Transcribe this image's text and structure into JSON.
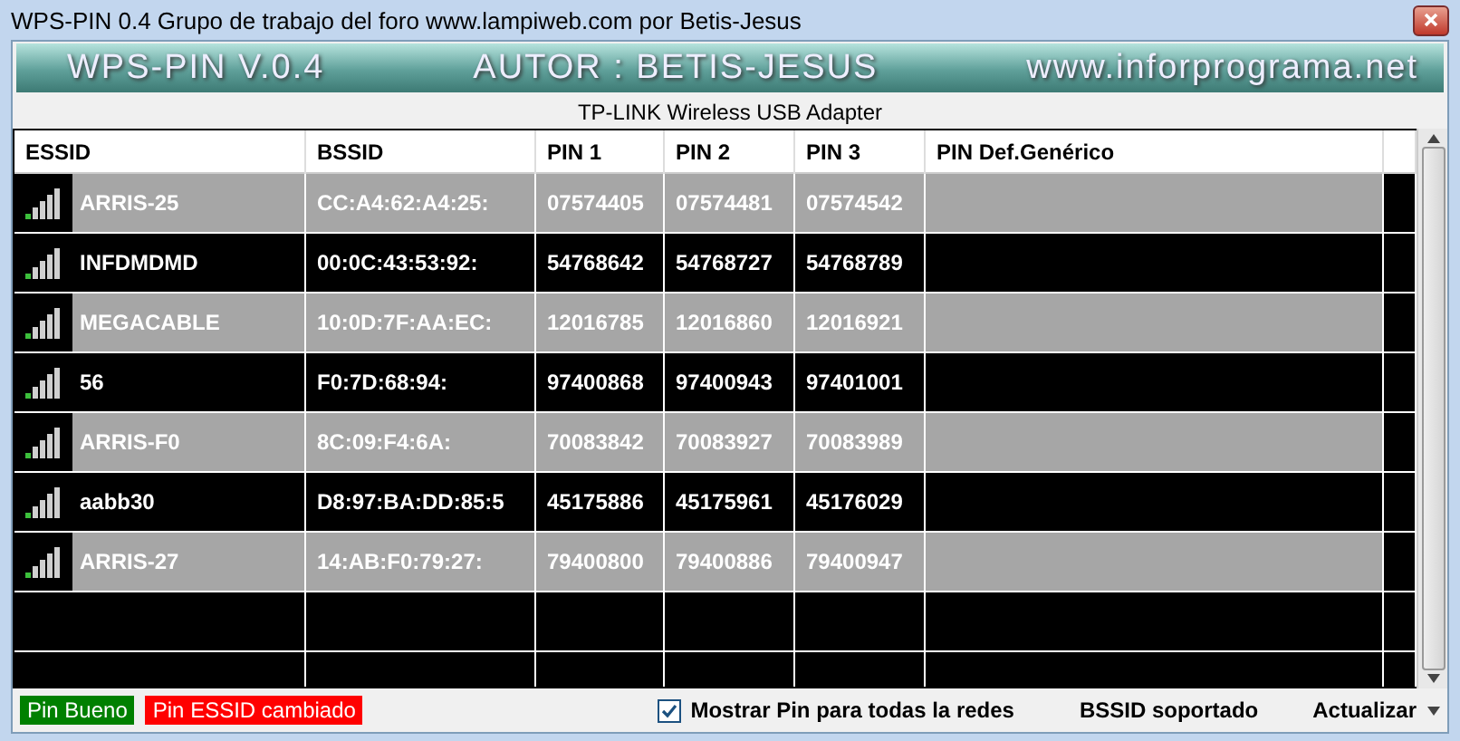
{
  "window": {
    "title": "WPS-PIN 0.4 Grupo de trabajo del foro www.lampiweb.com por Betis-Jesus"
  },
  "banner": [
    "WPS-PIN V.0.4",
    "AUTOR : BETIS-JESUS",
    "www.inforprograma.net"
  ],
  "adapter": "TP-LINK Wireless USB Adapter",
  "table": {
    "columns": [
      "ESSID",
      "BSSID",
      "PIN 1",
      "PIN 2",
      "PIN 3",
      "PIN Def.Genérico"
    ],
    "rows": [
      {
        "essid": "ARRIS-25",
        "bssid": "CC:A4:62:A4:25:",
        "pin1": "07574405",
        "pin2": "07574481",
        "pin3": "07574542"
      },
      {
        "essid": "INFDMDMD",
        "bssid": "00:0C:43:53:92:",
        "pin1": "54768642",
        "pin2": "54768727",
        "pin3": "54768789"
      },
      {
        "essid": "MEGACABLE",
        "bssid": "10:0D:7F:AA:EC:",
        "pin1": "12016785",
        "pin2": "12016860",
        "pin3": "12016921"
      },
      {
        "essid": "56",
        "bssid": "F0:7D:68:94:",
        "pin1": "97400868",
        "pin2": "97400943",
        "pin3": "97401001"
      },
      {
        "essid": "ARRIS-F0",
        "bssid": "8C:09:F4:6A:",
        "pin1": "70083842",
        "pin2": "70083927",
        "pin3": "70083989"
      },
      {
        "essid": "aabb30",
        "bssid": "D8:97:BA:DD:85:5",
        "pin1": "45175886",
        "pin2": "45175961",
        "pin3": "45176029"
      },
      {
        "essid": "ARRIS-27",
        "bssid": "14:AB:F0:79:27:",
        "pin1": "79400800",
        "pin2": "79400886",
        "pin3": "79400947"
      }
    ]
  },
  "legend": [
    {
      "label": "Pin Bueno",
      "color": "#008000"
    },
    {
      "label": "Pin ESSID cambiado",
      "color": "#ff0000"
    }
  ],
  "show_all": {
    "label": "Mostrar Pin para todas la redes",
    "checked": true
  },
  "status_bssid": "BSSID soportado",
  "refresh": "Actualizar"
}
